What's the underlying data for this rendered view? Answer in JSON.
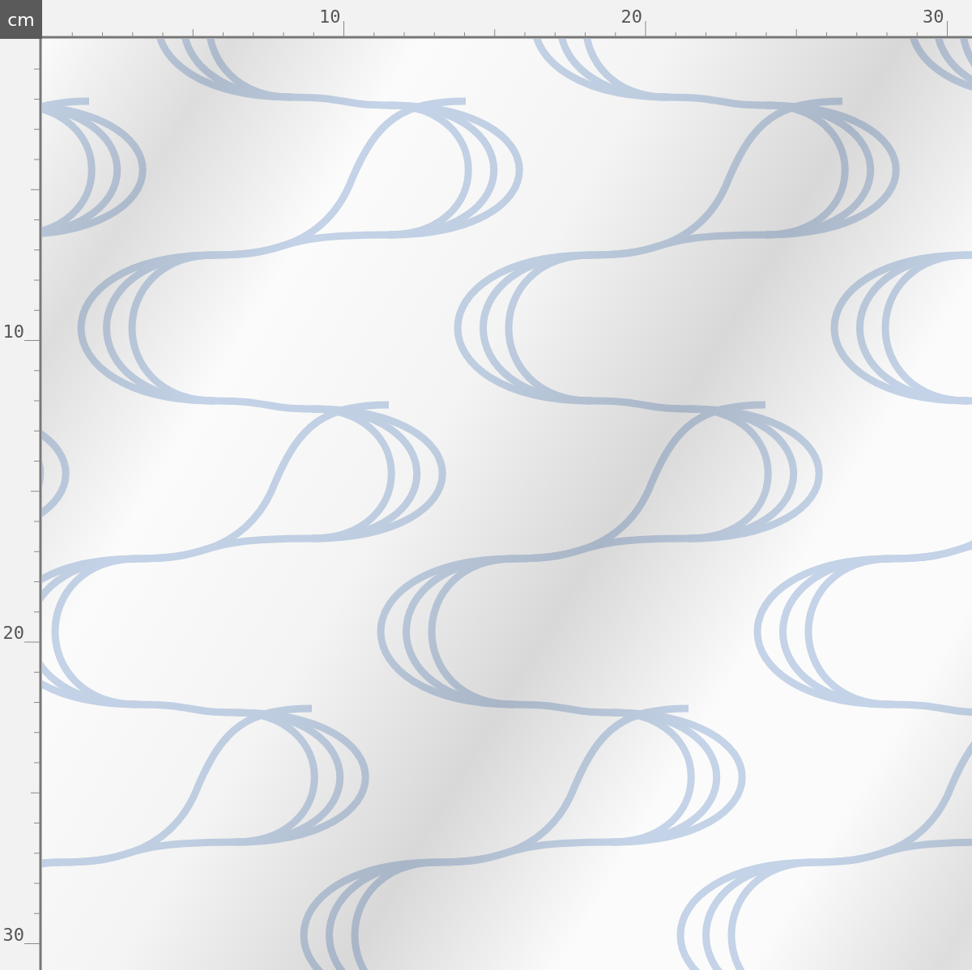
{
  "unit_label": "cm",
  "top_ruler": {
    "labels": [
      "10",
      "20",
      "30"
    ]
  },
  "left_ruler": {
    "labels": [
      "10",
      "20",
      "30"
    ]
  }
}
